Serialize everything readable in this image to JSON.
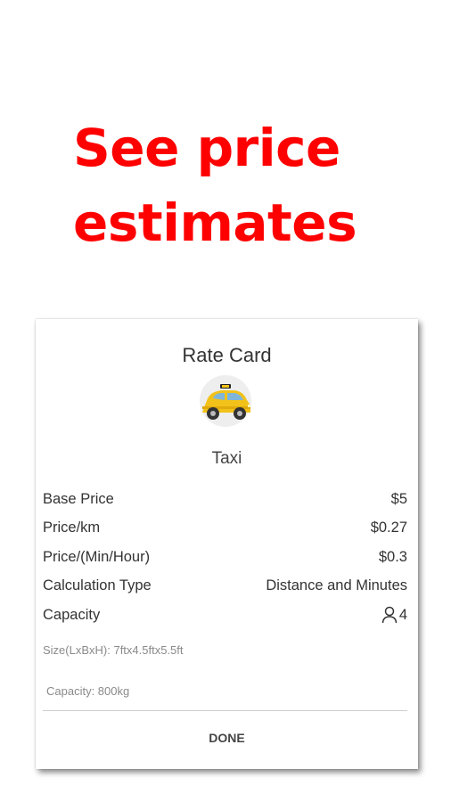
{
  "headline": "See price estimates",
  "rate_card": {
    "title": "Rate Card",
    "vehicle_icon": "taxi-car-image",
    "vehicle_name": "Taxi",
    "rows": [
      {
        "label": "Base Price",
        "value": "$5"
      },
      {
        "label": "Price/km",
        "value": "$0.27"
      },
      {
        "label": "Price/(Min/Hour)",
        "value": "$0.3"
      },
      {
        "label": "Calculation Type",
        "value": "Distance and Minutes"
      },
      {
        "label": "Capacity",
        "value": "4",
        "icon": "person-icon"
      }
    ],
    "size_text": "Size(LxBxH): 7ftx4.5ftx5.5ft",
    "capacity_text": "Capacity: 800kg",
    "done_label": "DONE"
  },
  "colors": {
    "headline": "#ff0000",
    "taxi_yellow": "#f2c21a"
  }
}
